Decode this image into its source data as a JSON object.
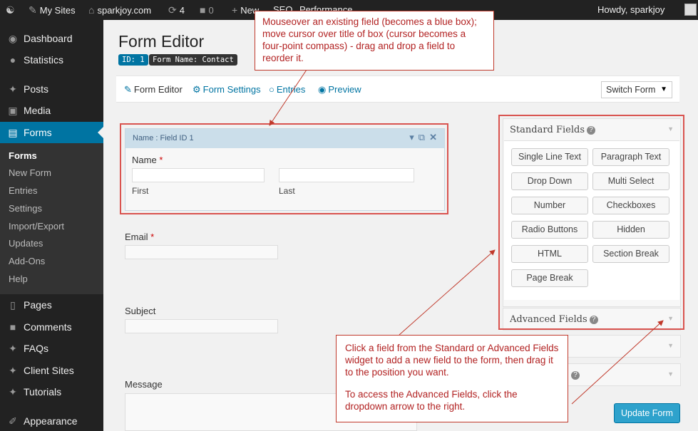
{
  "adminbar": {
    "my_sites": "My Sites",
    "site": "sparkjoy.com",
    "updates_count": "4",
    "comments_count": "0",
    "new": "New",
    "seo": "SEO",
    "performance": "Performance",
    "howdy": "Howdy, sparkjoy"
  },
  "sidebar": {
    "items": [
      {
        "label": "Dashboard",
        "icon": "dashboard-icon"
      },
      {
        "label": "Statistics",
        "icon": "statistics-icon"
      },
      {
        "label": "Posts",
        "icon": "pin-icon"
      },
      {
        "label": "Media",
        "icon": "media-icon"
      },
      {
        "label": "Forms",
        "icon": "forms-icon"
      },
      {
        "label": "Pages",
        "icon": "pages-icon"
      },
      {
        "label": "Comments",
        "icon": "comments-icon"
      },
      {
        "label": "FAQs",
        "icon": "pin-icon"
      },
      {
        "label": "Client Sites",
        "icon": "pin-icon"
      },
      {
        "label": "Tutorials",
        "icon": "pin-icon"
      },
      {
        "label": "Appearance",
        "icon": "appearance-icon"
      }
    ],
    "submenu": [
      "Forms",
      "New Form",
      "Entries",
      "Settings",
      "Import/Export",
      "Updates",
      "Add-Ons",
      "Help"
    ]
  },
  "page": {
    "title": "Form Editor",
    "id_badge": "ID: 1",
    "name_badge": "Form Name: Contact"
  },
  "toolbar": {
    "form_editor": "Form Editor",
    "form_settings": "Form Settings",
    "entries": "Entries",
    "preview": "Preview",
    "switch_form": "Switch Form"
  },
  "form": {
    "field_header": "Name : Field ID 1",
    "name_label": "Name",
    "required_mark": "*",
    "first": "First",
    "last": "Last",
    "email_label": "Email",
    "subject_label": "Subject",
    "message_label": "Message"
  },
  "widgets": {
    "standard_title": "Standard Fields",
    "advanced_title": "Advanced Fields",
    "standard_buttons": [
      "Single Line Text",
      "Paragraph Text",
      "Drop Down",
      "Multi Select",
      "Number",
      "Checkboxes",
      "Radio Buttons",
      "Hidden",
      "HTML",
      "Section Break",
      "Page Break"
    ],
    "update_button": "Update Form"
  },
  "callouts": {
    "top": "Mouseover an existing field (becomes a blue box); move cursor over title of box (cursor becomes a four-point compass) - drag and drop a field to reorder it.",
    "bottom_1": "Click a field from the Standard or Advanced Fields widget to add a new field to the form, then drag it to the position you want.",
    "bottom_2": "To access the Advanced Fields, click the dropdown arrow to the right."
  },
  "colors": {
    "accent": "#0074a2",
    "callout_text": "#b22222",
    "callout_border": "#c0392b"
  }
}
